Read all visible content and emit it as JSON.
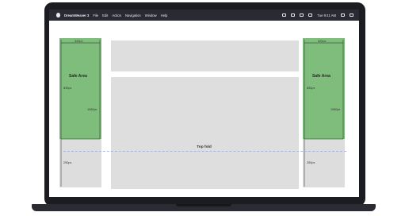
{
  "menubar": {
    "app_name": "DreamWeaver 3",
    "items": [
      "File",
      "Edit",
      "Action",
      "Navigation",
      "Window",
      "Help"
    ],
    "status_text": "Tue 9:41 AM"
  },
  "mockup": {
    "column_width_label": "320px",
    "safe_area_label": "Safe Area",
    "safe_height_label": "830px",
    "viewport_height_label": "1080px",
    "below_fold_label": "250px",
    "fold_label": "Top fold"
  },
  "colors": {
    "safe_area": "#7fbd7d",
    "placeholder": "#dedede",
    "menubar": "#2a2a33",
    "laptop": "#1b1b22",
    "fold_line": "#a8b7d8"
  },
  "icons": [
    "apple-icon",
    "notification-icon",
    "display-icon",
    "wifi-icon",
    "battery-icon",
    "search-icon",
    "control-center-icon"
  ]
}
